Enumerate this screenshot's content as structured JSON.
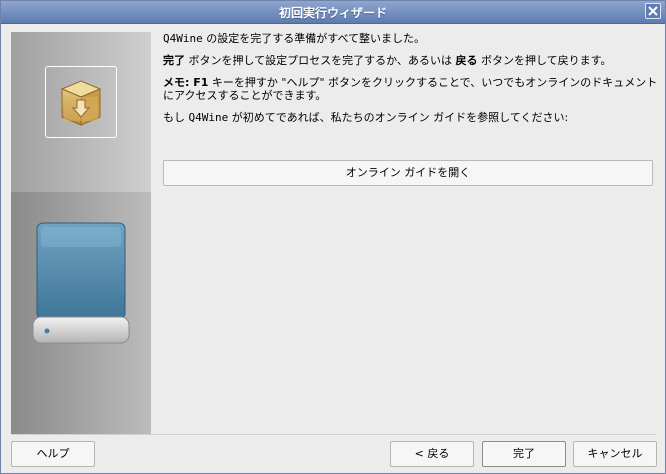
{
  "window": {
    "title": "初回実行ウィザード"
  },
  "content": {
    "line1": {
      "app": "Q4Wine",
      "text": " の設定を完了する準備がすべて整いました。"
    },
    "line2": {
      "finish": "完了",
      "text_a": " ボタンを押して設定プロセスを完了するか、あるいは ",
      "back": "戻る",
      "text_b": " ボタンを押して戻ります。"
    },
    "line3": {
      "memo": "メモ: F1",
      "text": " キーを押すか \"ヘルプ\" ボタンをクリックすることで、いつでもオンラインのドキュメントにアクセスすることができます。"
    },
    "line4": {
      "text_a": "もし ",
      "app": "Q4Wine",
      "text_b": " が初めてであれば、私たちのオンライン ガイドを参照してください:"
    },
    "guide_button": "オンライン ガイドを開く"
  },
  "buttons": {
    "help": "ヘルプ",
    "back": "< 戻る",
    "finish": "完了",
    "cancel": "キャンセル"
  },
  "icons": {
    "package": "package-icon",
    "drive": "drive-icon",
    "close": "close-icon"
  }
}
